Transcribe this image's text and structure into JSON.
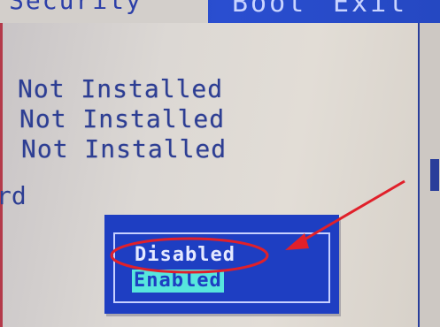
{
  "menu": {
    "selected_tab_fragment": "Security",
    "tabs": [
      {
        "label": "Boot"
      },
      {
        "label": "Exit"
      }
    ]
  },
  "rows": [
    {
      "value": "Not Installed"
    },
    {
      "value": "Not Installed"
    },
    {
      "value": "Not Installed"
    }
  ],
  "label_fragment": "rd",
  "popup": {
    "options": [
      {
        "label": "Disabled",
        "highlighted": false,
        "circled": true
      },
      {
        "label": "Enabled",
        "highlighted": true
      }
    ]
  },
  "colors": {
    "bios_blue": "#1e3ec2",
    "text_blue": "#2d3e93",
    "highlight_cyan": "#57e6dd",
    "annotation_red": "#e0202a"
  }
}
